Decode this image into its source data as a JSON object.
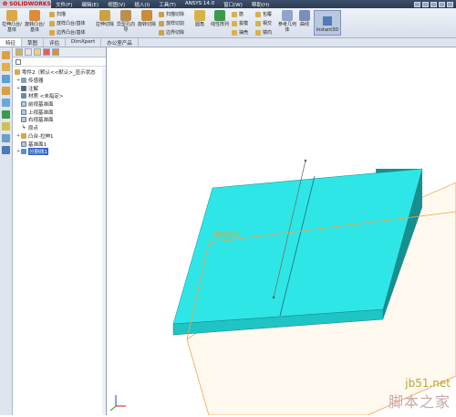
{
  "app": {
    "logo_text": "SOLIDWORKS",
    "menu": [
      "文件(F)",
      "编辑(E)",
      "视图(V)",
      "插入(I)",
      "工具(T)",
      "ANSYS 14.0",
      "窗口(W)",
      "帮助(H)"
    ]
  },
  "ribbon": {
    "big_buttons": [
      "拉伸凸台/基体",
      "旋转凸台/基体",
      "拉伸切除",
      "异型孔向导",
      "旋转切除",
      "圆角",
      "线性阵列",
      "筋",
      "拔模",
      "包覆",
      "相交",
      "参考几何体",
      "曲线"
    ],
    "small_buttons": [
      "扫描",
      "放样凸台/基体",
      "边界凸台/基体",
      "扫描切除",
      "放样切割",
      "边界切除",
      "抽壳",
      "镜向"
    ],
    "instant3d": "Instant3D"
  },
  "tabs": [
    "特征",
    "草图",
    "评估",
    "DimXpert",
    "办公室产品"
  ],
  "tree": [
    {
      "label": "零件2（默认<<默认>_显示状态",
      "level": 0
    },
    {
      "label": "传感器",
      "level": 1
    },
    {
      "label": "注解",
      "level": 1
    },
    {
      "label": "材质 <未指定>",
      "level": 1
    },
    {
      "label": "前视基准面",
      "level": 1
    },
    {
      "label": "上视基准面",
      "level": 1
    },
    {
      "label": "右视基准面",
      "level": 1
    },
    {
      "label": "原点",
      "level": 1
    },
    {
      "label": "凸台-拉伸1",
      "level": 1
    },
    {
      "label": "基准面1",
      "level": 1
    },
    {
      "label": "分割线1",
      "level": 1,
      "selected": true
    }
  ],
  "viewport": {
    "plane_label": "基准面1",
    "triad": "Z X Y"
  },
  "watermark": {
    "site": "jb51.net",
    "brand": "脚本之家"
  },
  "colors": {
    "box_top": "#2fe6e6",
    "box_front": "#1fc4c4",
    "box_side": "#178f8f",
    "plane_edge": "#f0a54a",
    "plane_label": "#f0a030",
    "selected": "#3366cc"
  }
}
